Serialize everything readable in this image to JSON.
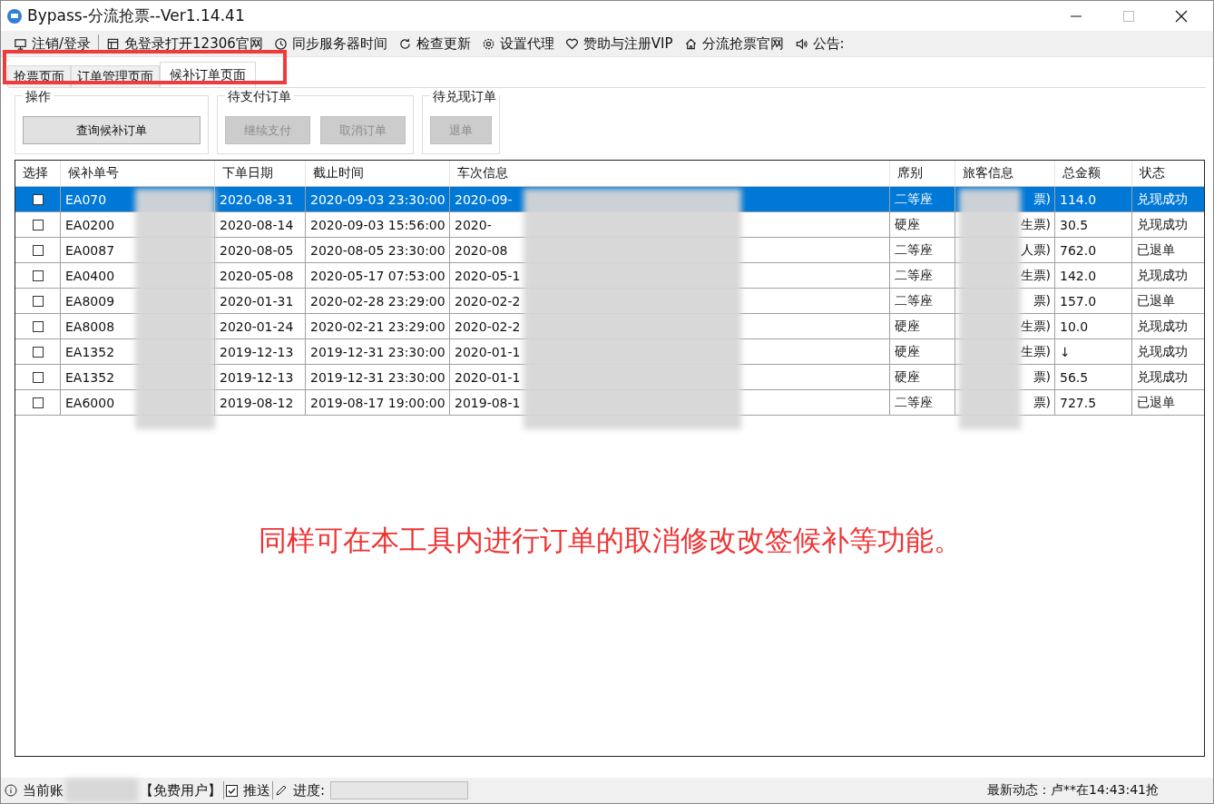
{
  "window": {
    "title": "Bypass-分流抢票--Ver1.14.41"
  },
  "toolbar": [
    {
      "kind": "monitor",
      "label": "注销/登录"
    },
    {
      "kind": "window",
      "label": "免登录打开12306官网"
    },
    {
      "kind": "clock",
      "label": "同步服务器时间"
    },
    {
      "kind": "refresh",
      "label": "检查更新"
    },
    {
      "kind": "gear",
      "label": "设置代理"
    },
    {
      "kind": "heart",
      "label": "赞助与注册VIP"
    },
    {
      "kind": "home",
      "label": "分流抢票官网"
    },
    {
      "kind": "speaker",
      "label": "公告:"
    }
  ],
  "tabs": [
    {
      "label": "抢票页面",
      "selected": false
    },
    {
      "label": "订单管理页面",
      "selected": false
    },
    {
      "label": "候补订单页面",
      "selected": true
    }
  ],
  "groups": [
    {
      "title": "操作",
      "buttons": [
        {
          "label": "查询候补订单",
          "disabled": false
        }
      ]
    },
    {
      "title": "待支付订单",
      "buttons": [
        {
          "label": "继续支付",
          "disabled": true
        },
        {
          "label": "取消订单",
          "disabled": true
        }
      ]
    },
    {
      "title": "待兑现订单",
      "buttons": [
        {
          "label": "退单",
          "disabled": true
        }
      ]
    }
  ],
  "table": {
    "columns": [
      "选择",
      "候补单号",
      "下单日期",
      "截止时间",
      "车次信息",
      "席别",
      "旅客信息",
      "总金额",
      "状态"
    ],
    "rows": [
      {
        "selected": true,
        "checked": false,
        "cells": [
          "",
          "EA070",
          "2020-08-31",
          "2020-09-03 23:30:00",
          "2020-09-",
          "二等座",
          "票)",
          "114.0",
          "兑现成功"
        ]
      },
      {
        "selected": false,
        "checked": false,
        "cells": [
          "",
          "EA0200",
          "2020-08-14",
          "2020-09-03 15:56:00",
          "2020-",
          "硬座",
          "生票)",
          "30.5",
          "兑现成功"
        ]
      },
      {
        "selected": false,
        "checked": false,
        "cells": [
          "",
          "EA0087",
          "2020-08-05",
          "2020-08-05 23:30:00",
          "2020-08",
          "二等座",
          "人票)",
          "762.0",
          "已退单"
        ]
      },
      {
        "selected": false,
        "checked": false,
        "cells": [
          "",
          "EA0400",
          "2020-05-08",
          "2020-05-17 07:53:00",
          "2020-05-1",
          "二等座",
          "生票)",
          "142.0",
          "兑现成功"
        ]
      },
      {
        "selected": false,
        "checked": false,
        "cells": [
          "",
          "EA8009",
          "2020-01-31",
          "2020-02-28 23:29:00",
          "2020-02-2",
          "二等座",
          "票)",
          "157.0",
          "已退单"
        ]
      },
      {
        "selected": false,
        "checked": false,
        "cells": [
          "",
          "EA8008",
          "2020-01-24",
          "2020-02-21 23:29:00",
          "2020-02-2",
          "硬座",
          "生票)",
          "10.0",
          "兑现成功"
        ]
      },
      {
        "selected": false,
        "checked": false,
        "cells": [
          "",
          "EA1352",
          "2019-12-13",
          "2019-12-31 23:30:00",
          "2020-01-1",
          "硬座",
          "生票)",
          "↓",
          "兑现成功"
        ]
      },
      {
        "selected": false,
        "checked": false,
        "cells": [
          "",
          "EA1352",
          "2019-12-13",
          "2019-12-31 23:30:00",
          "2020-01-1",
          "硬座",
          "票)",
          "56.5",
          "兑现成功"
        ]
      },
      {
        "selected": false,
        "checked": false,
        "cells": [
          "",
          "EA6000",
          "2019-08-12",
          "2019-08-17 19:00:00",
          "2019-08-1",
          "二等座",
          "票)",
          "727.5",
          "已退单"
        ]
      }
    ]
  },
  "annotation": "同样可在本工具内进行订单的取消修改改签候补等功能。",
  "status_bar": {
    "account_label": "当前账",
    "user_type": "【免费用户】",
    "push": {
      "label": "推送",
      "checked": true
    },
    "progress": {
      "label": "进度:",
      "level": 0
    },
    "news": "最新动态：卢**在14:43:41抢"
  }
}
